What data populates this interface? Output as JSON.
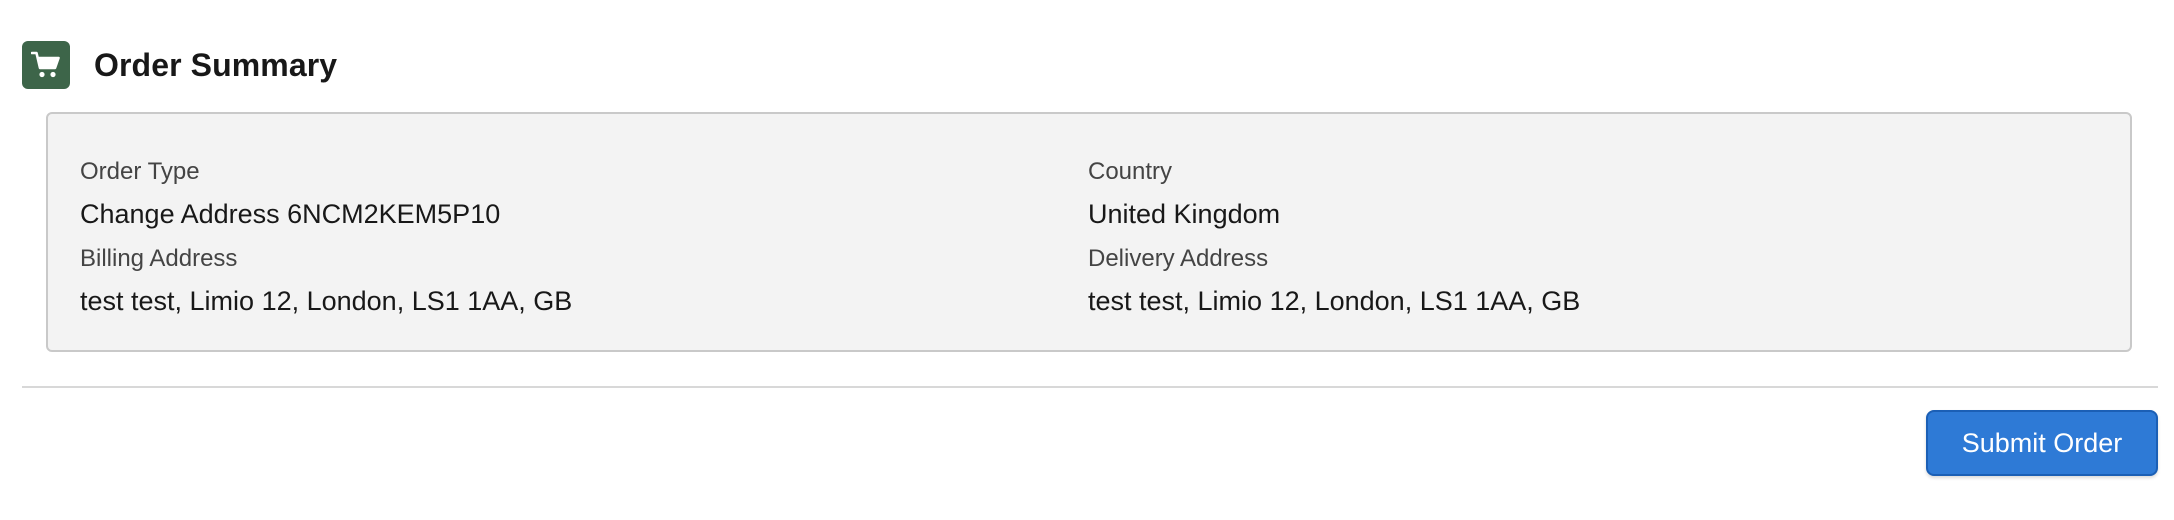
{
  "header": {
    "icon": "shopping-cart-icon",
    "title": "Order Summary",
    "icon_bg_color": "#3d6549"
  },
  "summary": {
    "order_type": {
      "label": "Order Type",
      "value": "Change Address 6NCM2KEM5P10"
    },
    "country": {
      "label": "Country",
      "value": "United Kingdom"
    },
    "billing_address": {
      "label": "Billing Address",
      "value": "test test, Limio 12, London, LS1 1AA, GB"
    },
    "delivery_address": {
      "label": "Delivery Address",
      "value": "test test, Limio 12, London, LS1 1AA, GB"
    }
  },
  "actions": {
    "submit_label": "Submit Order",
    "submit_color": "#2e7ad6"
  }
}
